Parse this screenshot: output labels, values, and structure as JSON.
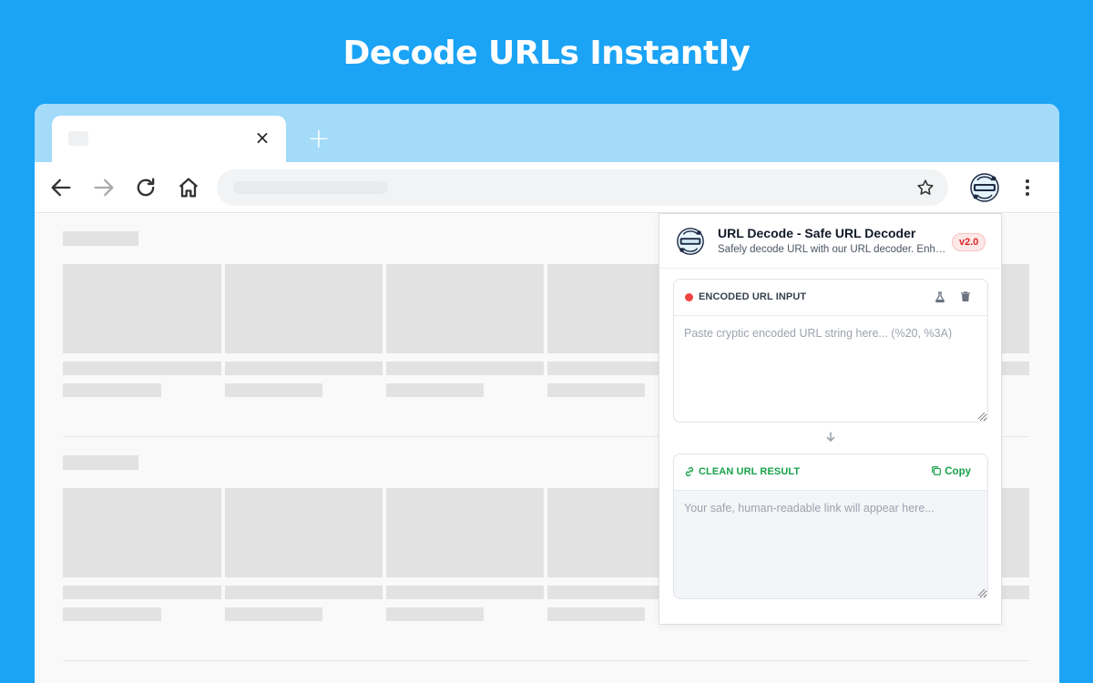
{
  "hero": {
    "title": "Decode URLs Instantly"
  },
  "browser": {
    "tab": {
      "close_glyph": "×",
      "new_tab_glyph": "+"
    },
    "toolbar": {
      "icons": [
        "back-arrow-icon",
        "forward-arrow-icon",
        "reload-icon",
        "home-icon",
        "star-icon",
        "extension-icon",
        "kebab-menu-icon"
      ]
    }
  },
  "popup": {
    "title": "URL Decode - Safe URL Decoder",
    "subtitle": "Safely decode URL with our URL decoder. Enhance your web browsing with a safe decoder.",
    "version": "v2.0",
    "input_panel": {
      "label": "ENCODED URL INPUT",
      "placeholder": "Paste cryptic encoded URL string here... (%20, %3A)",
      "icons": [
        "flask-icon",
        "trash-icon"
      ],
      "status_color": "#ef4444"
    },
    "output_panel": {
      "label": "CLEAN URL RESULT",
      "placeholder": "Your safe, human-readable link will appear here...",
      "copy_label": "Copy",
      "accent_color": "#16a34a"
    }
  },
  "colors": {
    "background": "#1ba3f5",
    "tabstrip": "#a3dbf9",
    "badge_text": "#dc2626",
    "badge_bg": "#fde8e8"
  }
}
